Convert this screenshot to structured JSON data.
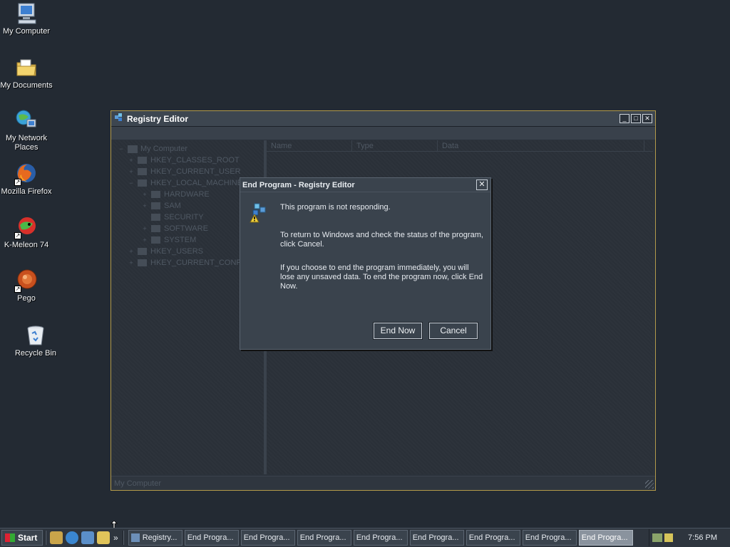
{
  "desktop": {
    "icons": [
      {
        "label": "My Computer"
      },
      {
        "label": "My Documents"
      },
      {
        "label": "My Network Places"
      },
      {
        "label": "Mozilla Firefox"
      },
      {
        "label": "K-Meleon 74"
      },
      {
        "label": "Pego"
      },
      {
        "label": "Recycle Bin"
      }
    ]
  },
  "registry_window": {
    "title": "Registry Editor",
    "tree": [
      {
        "label": "My Computer",
        "toggle": "−"
      },
      {
        "label": "HKEY_CLASSES_ROOT",
        "toggle": "+"
      },
      {
        "label": "HKEY_CURRENT_USER",
        "toggle": "+"
      },
      {
        "label": "HKEY_LOCAL_MACHINE",
        "toggle": "−"
      },
      {
        "label": "HARDWARE",
        "toggle": "+"
      },
      {
        "label": "SAM",
        "toggle": "+"
      },
      {
        "label": "SECURITY",
        "toggle": ""
      },
      {
        "label": "SOFTWARE",
        "toggle": "+"
      },
      {
        "label": "SYSTEM",
        "toggle": "+"
      },
      {
        "label": "HKEY_USERS",
        "toggle": "+"
      },
      {
        "label": "HKEY_CURRENT_CONFIG",
        "toggle": "+"
      }
    ],
    "columns": [
      "Name",
      "Type",
      "Data"
    ],
    "status": "My Computer"
  },
  "dialog": {
    "title": "End Program - Registry Editor",
    "close_label": "✕",
    "line1": "This program is not responding.",
    "line2": "To return to Windows and check the status of the program, click Cancel.",
    "line3": "If you choose to end the program immediately, you will lose any unsaved data. To end the program now, click End Now.",
    "end_now_label": "End Now",
    "cancel_label": "Cancel"
  },
  "taskbar": {
    "start_label": "Start",
    "chevron": "»",
    "buttons": [
      {
        "label": "Registry..."
      },
      {
        "label": "End Progra..."
      },
      {
        "label": "End Progra..."
      },
      {
        "label": "End Progra..."
      },
      {
        "label": "End Progra..."
      },
      {
        "label": "End Progra..."
      },
      {
        "label": "End Progra..."
      },
      {
        "label": "End Progra..."
      },
      {
        "label": "End Progra..."
      }
    ],
    "clock": "7:56 PM"
  },
  "colors": {
    "desktop_bg": "#232a33",
    "window_border": "#b39a4a",
    "active_task": "#8a939e"
  }
}
